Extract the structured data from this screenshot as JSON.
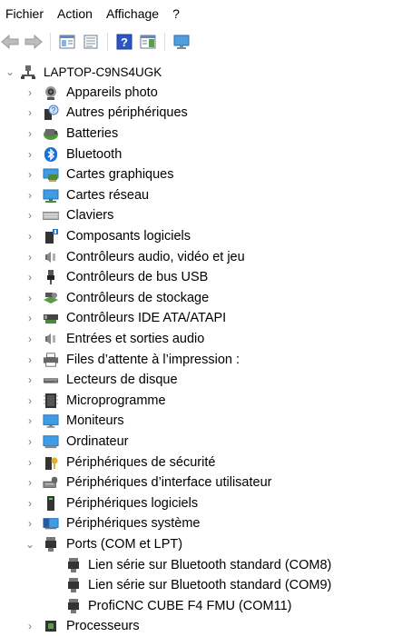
{
  "menu": [
    "Fichier",
    "Action",
    "Affichage",
    "?"
  ],
  "toolbar": {
    "buttons": [
      "back-arrow-icon",
      "forward-arrow-icon",
      "properties-pane-icon",
      "properties-sheet-icon",
      "help-icon",
      "action-pane-icon",
      "monitor-scan-icon"
    ]
  },
  "tree": {
    "root": "LAPTOP-C9NS4UGK",
    "categories": [
      {
        "label": "Appareils photo",
        "icon": "camera-icon"
      },
      {
        "label": "Autres périphériques",
        "icon": "unknown-device-icon"
      },
      {
        "label": "Batteries",
        "icon": "battery-icon"
      },
      {
        "label": "Bluetooth",
        "icon": "bluetooth-icon"
      },
      {
        "label": "Cartes graphiques",
        "icon": "display-adapter-icon"
      },
      {
        "label": "Cartes réseau",
        "icon": "network-adapter-icon"
      },
      {
        "label": "Claviers",
        "icon": "keyboard-icon"
      },
      {
        "label": "Composants logiciels",
        "icon": "software-component-icon"
      },
      {
        "label": "Contrôleurs audio, vidéo et jeu",
        "icon": "speaker-icon"
      },
      {
        "label": "Contrôleurs de bus USB",
        "icon": "usb-icon"
      },
      {
        "label": "Contrôleurs de stockage",
        "icon": "storage-controller-icon"
      },
      {
        "label": "Contrôleurs IDE ATA/ATAPI",
        "icon": "ide-controller-icon"
      },
      {
        "label": "Entrées et sorties audio",
        "icon": "speaker-icon"
      },
      {
        "label": "Files d’attente à l’impression :",
        "icon": "printer-icon"
      },
      {
        "label": "Lecteurs de disque",
        "icon": "disk-drive-icon"
      },
      {
        "label": "Microprogramme",
        "icon": "firmware-icon"
      },
      {
        "label": "Moniteurs",
        "icon": "monitor-icon"
      },
      {
        "label": "Ordinateur",
        "icon": "computer-icon"
      },
      {
        "label": "Périphériques de sécurité",
        "icon": "security-key-icon"
      },
      {
        "label": "Périphériques d’interface utilisateur",
        "icon": "hid-icon"
      },
      {
        "label": "Périphériques logiciels",
        "icon": "software-device-icon"
      },
      {
        "label": "Périphériques système",
        "icon": "system-device-icon"
      },
      {
        "label": "Ports (COM et LPT)",
        "icon": "port-icon",
        "expanded": true
      }
    ],
    "ports": [
      "Lien série sur Bluetooth standard (COM8)",
      "Lien série sur Bluetooth standard (COM9)",
      "ProfiCNC CUBE F4 FMU (COM11)"
    ],
    "next_partial": "Processeurs"
  }
}
